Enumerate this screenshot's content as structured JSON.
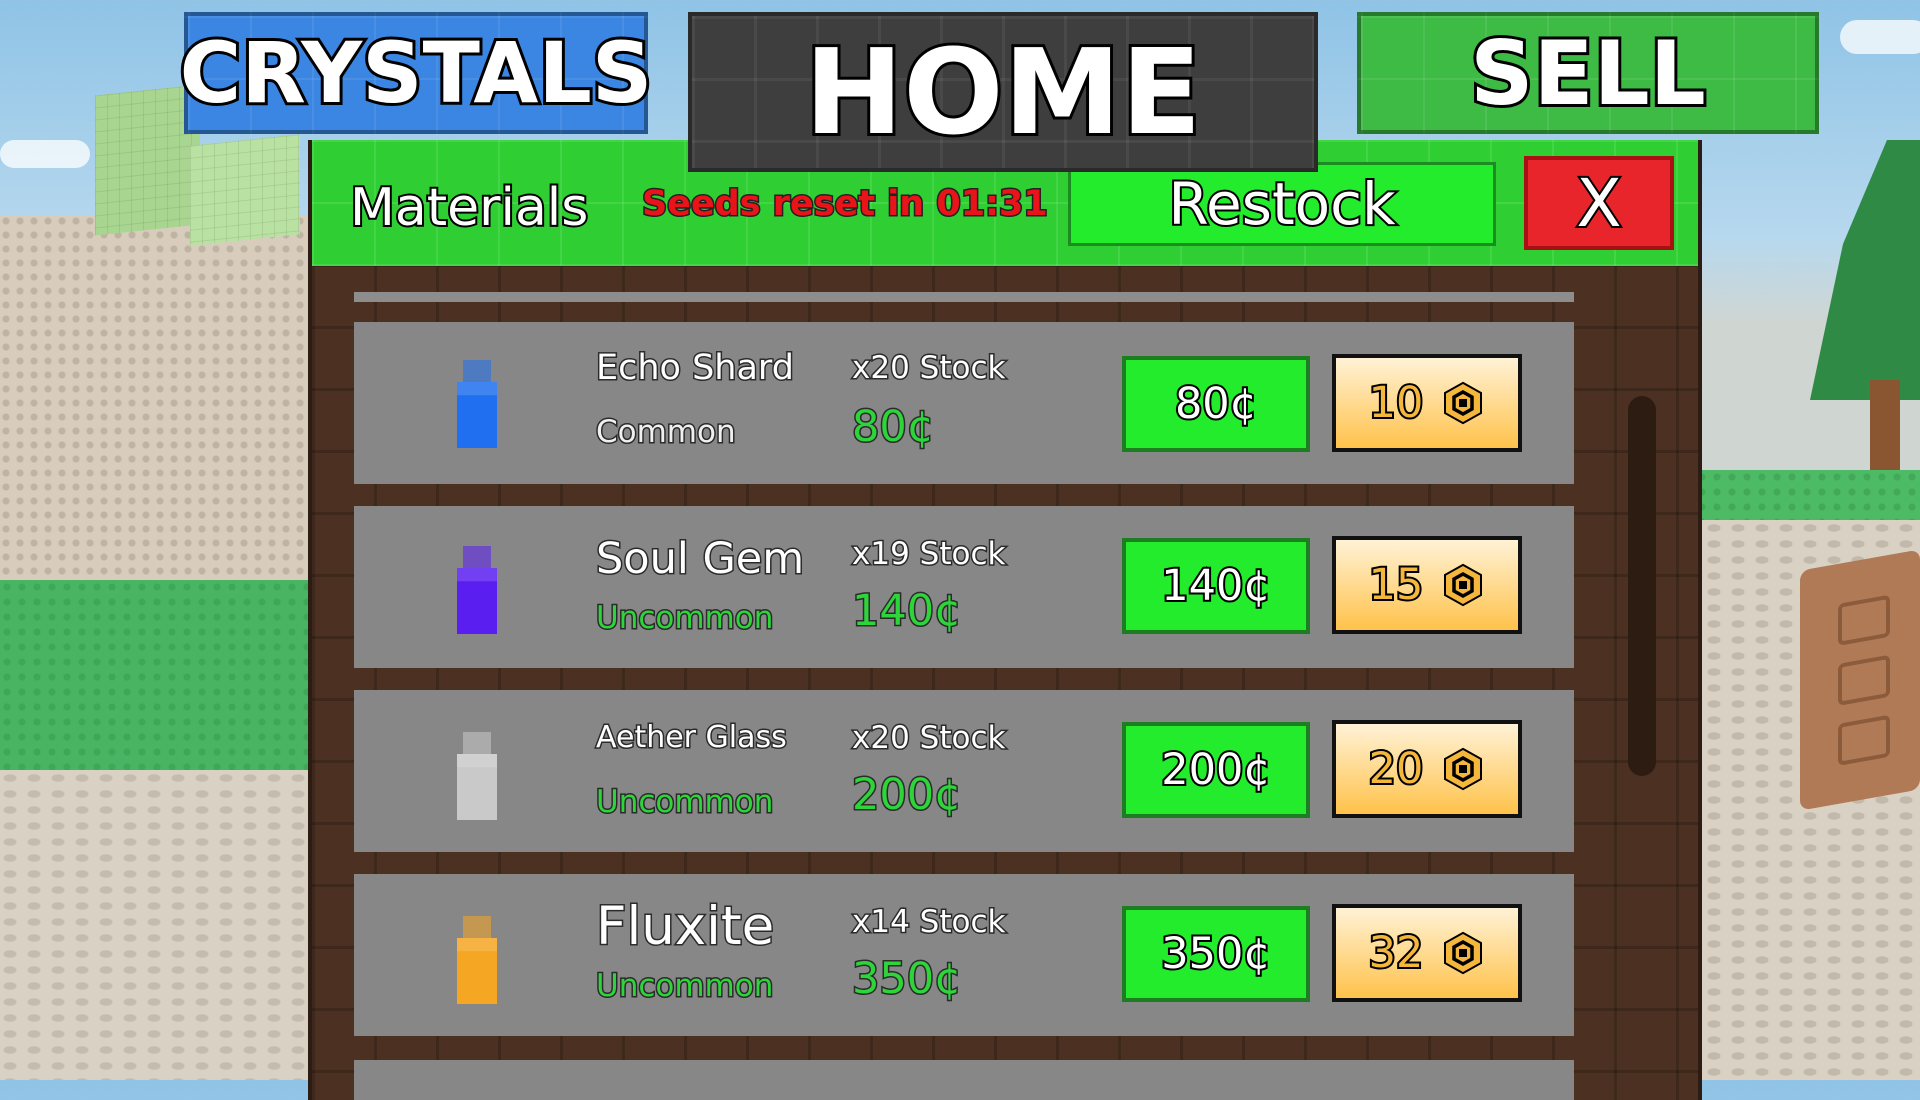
{
  "nav": {
    "crystals": "CRYSTALS",
    "home": "HOME",
    "sell": "SELL"
  },
  "panel": {
    "title": "Materials",
    "reset_text": "Seeds reset in 01:31",
    "restock_label": "Restock",
    "close_label": "X"
  },
  "items": [
    {
      "name": "Echo Shard",
      "rarity": "Common",
      "stock": "x20 Stock",
      "price": "80¢",
      "buy_cash": "80¢",
      "buy_robux": "10",
      "color": "#1f6ff0",
      "rarity_color": "#f0f0f0"
    },
    {
      "name": "Soul Gem",
      "rarity": "Uncommon",
      "stock": "x19 Stock",
      "price": "140¢",
      "buy_cash": "140¢",
      "buy_robux": "15",
      "color": "#5a1ff0",
      "rarity_color": "#2dd43a"
    },
    {
      "name": "Aether Glass",
      "rarity": "Uncommon",
      "stock": "x20 Stock",
      "price": "200¢",
      "buy_cash": "200¢",
      "buy_robux": "20",
      "color": "#c9c9c9",
      "rarity_color": "#2dd43a"
    },
    {
      "name": "Fluxite",
      "rarity": "Uncommon",
      "stock": "x14 Stock",
      "price": "350¢",
      "buy_cash": "350¢",
      "buy_robux": "32",
      "color": "#f5a623",
      "rarity_color": "#2dd43a"
    }
  ],
  "icons": {
    "currency": "robux-icon",
    "item": "bottle-icon"
  },
  "colors": {
    "header_green": "#2fcf33",
    "buy_green": "#23ec2c",
    "close_red": "#e8252a",
    "crystals_blue": "#3a86e2",
    "home_gray": "#3e3e3e",
    "sell_green": "#3dbb44",
    "row_gray": "#878787",
    "panel_brown": "#4c3122"
  }
}
